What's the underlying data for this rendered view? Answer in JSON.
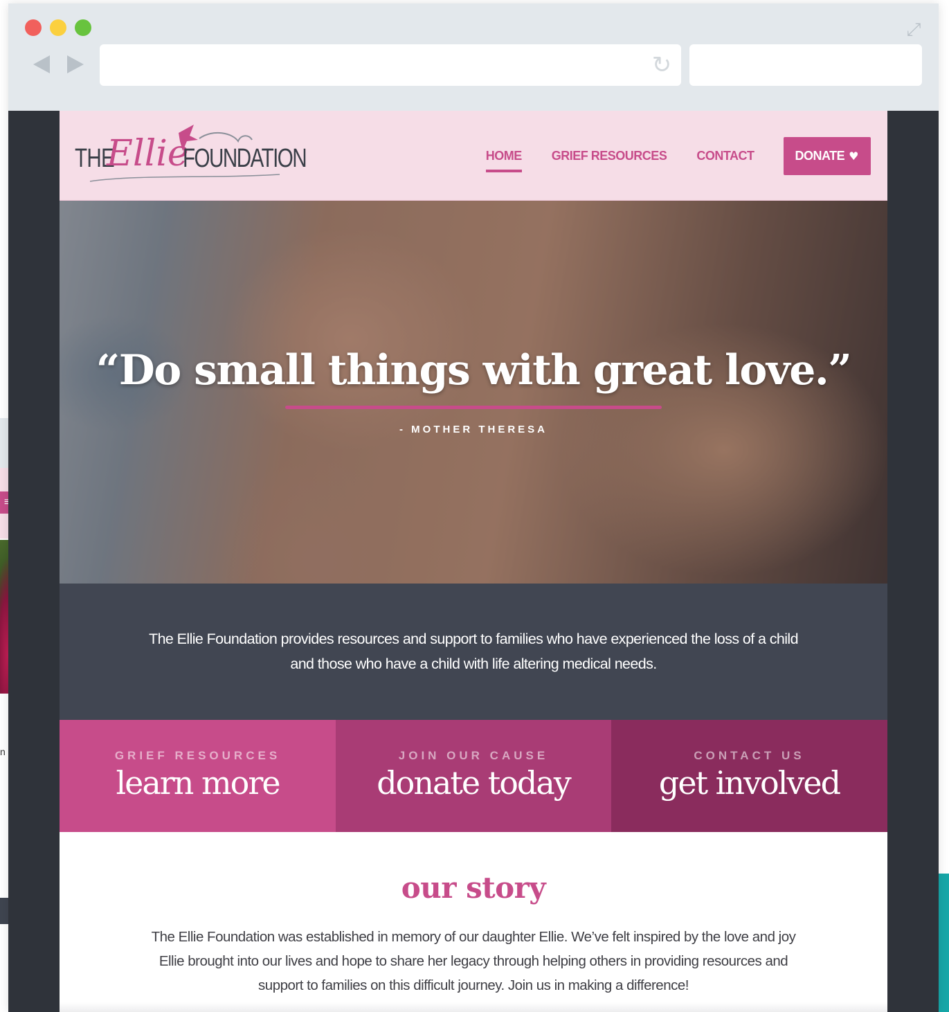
{
  "site": {
    "logo": {
      "the": "THE",
      "ellie": "Ellie",
      "foundation": "FOUNDATION"
    },
    "nav": [
      {
        "label": "HOME",
        "active": true
      },
      {
        "label": "GRIEF RESOURCES",
        "active": false
      },
      {
        "label": "CONTACT",
        "active": false
      }
    ],
    "donate_label": "DONATE",
    "hero": {
      "quote": "“Do small things with great love.”",
      "author": "- MOTHER THERESA"
    },
    "mission": "The Ellie Foundation provides resources and support to families who have experienced the loss of a child and those who have a child with life altering medical needs.",
    "cta": [
      {
        "kicker": "GRIEF RESOURCES",
        "label": "learn more",
        "color": "#c74c8a"
      },
      {
        "kicker": "JOIN OUR CAUSE",
        "label": "donate today",
        "color": "#a93c75"
      },
      {
        "kicker": "CONTACT US",
        "label": "get involved",
        "color": "#8a2c5d"
      }
    ],
    "story": {
      "title": "our story",
      "text": "The Ellie Foundation was established in memory of our daughter Ellie. We’ve felt inspired by the love and joy Ellie brought into our lives and hope to share her legacy through helping others in providing resources and support to families on this difficult journey. Join us in making a difference!"
    }
  },
  "mobile_preview": {
    "menu_icon": "hamburger-icon",
    "text_fragment": "n"
  },
  "browser": {
    "icons": [
      "close-dot",
      "minimize-dot",
      "zoom-dot",
      "back-arrow-icon",
      "forward-arrow-icon",
      "reload-icon",
      "expand-icon"
    ]
  },
  "colors": {
    "brand_pink": "#c74c8a",
    "header_bg": "#f6dde7",
    "mission_bg": "#414652",
    "chrome_bg": "#e3e8ec",
    "accent_teal": "#17a7a8"
  }
}
